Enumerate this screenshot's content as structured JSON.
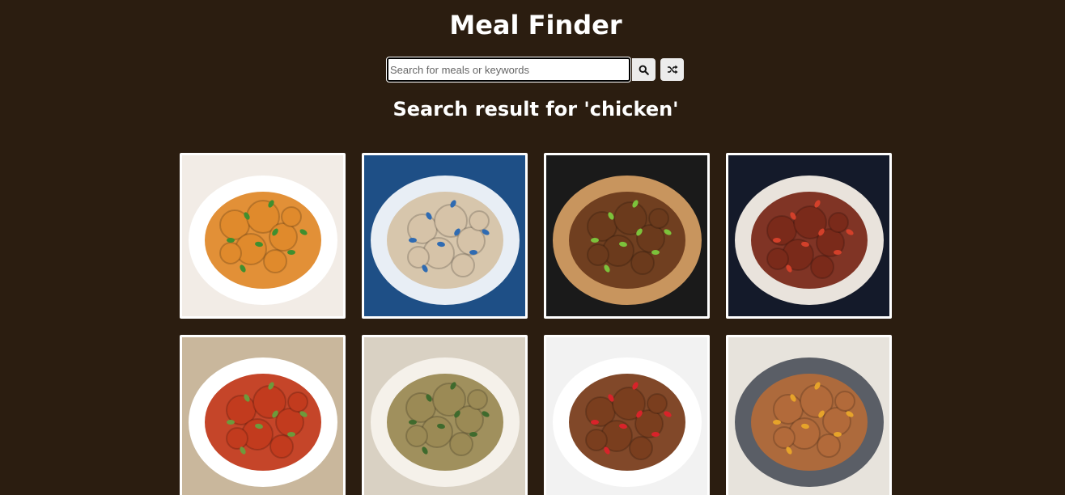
{
  "app": {
    "title": "Meal Finder"
  },
  "search": {
    "placeholder": "Search for meals or keywords",
    "value": "",
    "search_icon": "search-icon",
    "random_icon": "shuffle-icon"
  },
  "results": {
    "heading": "Search result for 'chicken'",
    "meals": [
      {
        "icon": "chicken-curry-photo",
        "colors": {
          "bg": "#f2ece6",
          "plate": "#ffffff",
          "food": "#e08a2c",
          "accent": "#3f8f2f"
        }
      },
      {
        "icon": "congee-bowl-photo",
        "colors": {
          "bg": "#1e4f86",
          "plate": "#e8eef5",
          "food": "#d6c3a8",
          "accent": "#2f6bb2"
        }
      },
      {
        "icon": "chicken-sandwich-photo",
        "colors": {
          "bg": "#1a1a1a",
          "plate": "#c8955e",
          "food": "#6b3a1c",
          "accent": "#7cc23b"
        }
      },
      {
        "icon": "chicken-casserole-photo",
        "colors": {
          "bg": "#141a2a",
          "plate": "#e9e3dc",
          "food": "#7a2a1a",
          "accent": "#d3402a"
        }
      },
      {
        "icon": "tandoori-chicken-photo",
        "colors": {
          "bg": "#c9b79c",
          "plate": "#ffffff",
          "food": "#c23b1e",
          "accent": "#6d9a3c"
        }
      },
      {
        "icon": "chicken-grains-photo",
        "colors": {
          "bg": "#d9d1c3",
          "plate": "#f5f1ea",
          "food": "#9b8a55",
          "accent": "#3f6a2d"
        }
      },
      {
        "icon": "chicken-stir-fry-photo",
        "colors": {
          "bg": "#f2f2f2",
          "plate": "#ffffff",
          "food": "#7a3e1e",
          "accent": "#d8232a"
        }
      },
      {
        "icon": "chicken-stew-pan-photo",
        "colors": {
          "bg": "#e7e3dc",
          "plate": "#5a5e66",
          "food": "#b26a3a",
          "accent": "#e6a32a"
        }
      }
    ]
  }
}
